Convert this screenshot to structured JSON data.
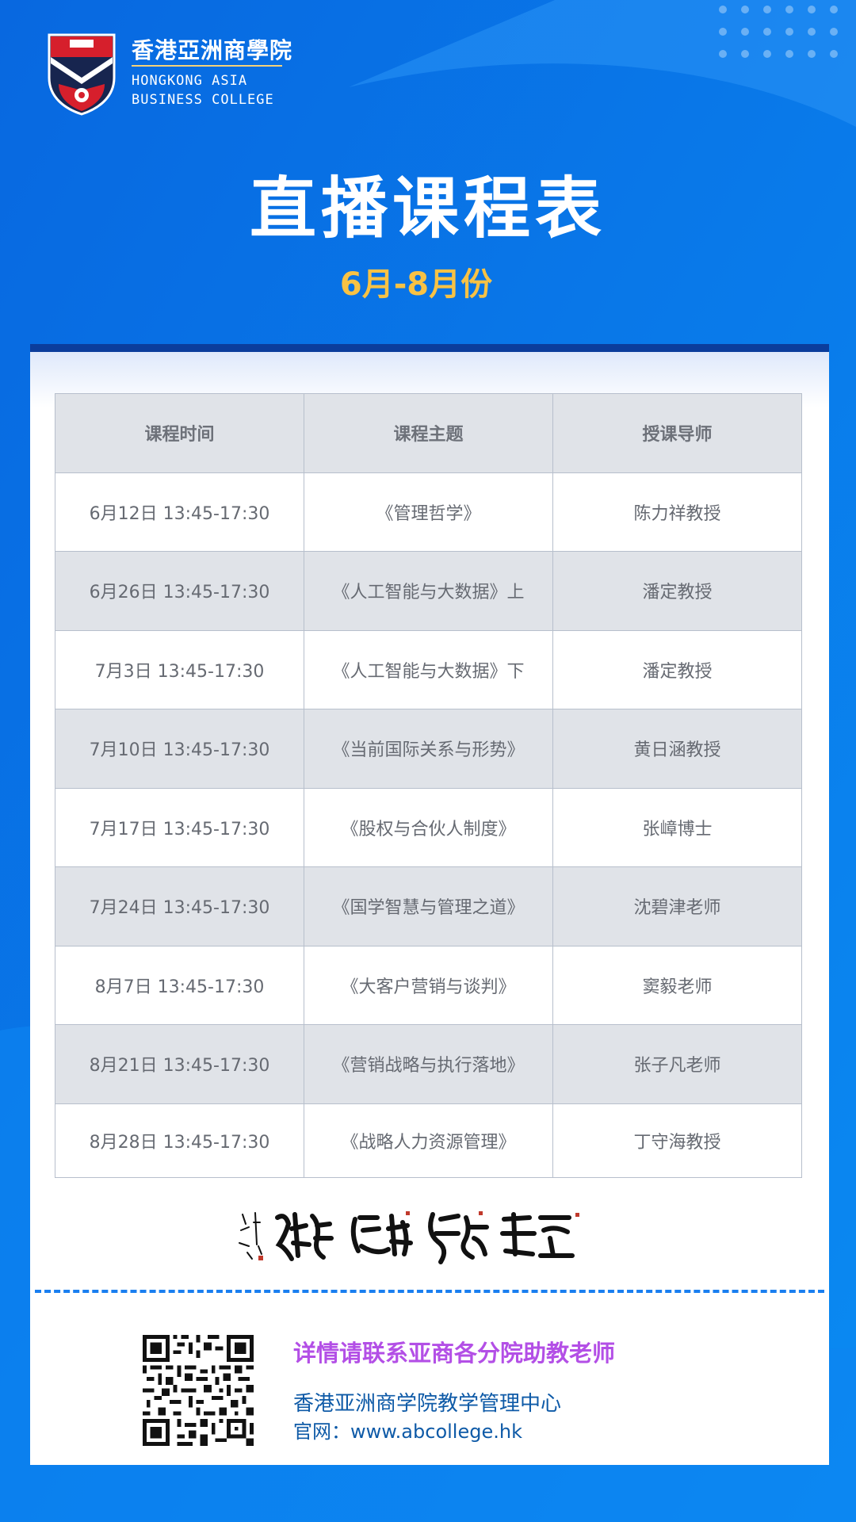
{
  "header": {
    "school_name_cn": "香港亞洲商學院",
    "school_name_en_line1": "HONGKONG ASIA",
    "school_name_en_line2": "BUSINESS COLLEGE",
    "title": "直播课程表",
    "subtitle": "6月-8月份"
  },
  "schedule": {
    "columns": [
      "课程时间",
      "课程主题",
      "授课导师"
    ],
    "rows": [
      {
        "time": "6月12日 13:45-17:30",
        "topic": "《管理哲学》",
        "teacher": "陈力祥教授"
      },
      {
        "time": "6月26日 13:45-17:30",
        "topic": "《人工智能与大数据》上",
        "teacher": "潘定教授"
      },
      {
        "time": "7月3日 13:45-17:30",
        "topic": "《人工智能与大数据》下",
        "teacher": "潘定教授"
      },
      {
        "time": "7月10日 13:45-17:30",
        "topic": "《当前国际关系与形势》",
        "teacher": "黄日涵教授"
      },
      {
        "time": "7月17日 13:45-17:30",
        "topic": "《股权与合伙人制度》",
        "teacher": "张嶂博士"
      },
      {
        "time": "7月24日 13:45-17:30",
        "topic": "《国学智慧与管理之道》",
        "teacher": "沈碧津老师"
      },
      {
        "time": "8月7日 13:45-17:30",
        "topic": "《大客户营销与谈判》",
        "teacher": "窦毅老师"
      },
      {
        "time": "8月21日 13:45-17:30",
        "topic": "《营销战略与执行落地》",
        "teacher": "张子凡老师"
      },
      {
        "time": "8月28日 13:45-17:30",
        "topic": "《战略人力资源管理》",
        "teacher": "丁守海教授"
      }
    ]
  },
  "motto": {
    "text": "術精 道怡 勢錫 善至"
  },
  "footer": {
    "contact_heading": "详情请联系亚商各分院助教老师",
    "organization": "香港亚洲商学院教学管理中心",
    "website": "官网：www.abcollege.hk"
  },
  "colors": {
    "background": "#0a72e8",
    "subtitle": "#f8c244",
    "contact_heading": "#b34fe6",
    "contact_text": "#0e5aa7",
    "header_row": "#e0e3e8"
  },
  "icons": [
    "school-crest-icon",
    "qr-code-icon"
  ]
}
